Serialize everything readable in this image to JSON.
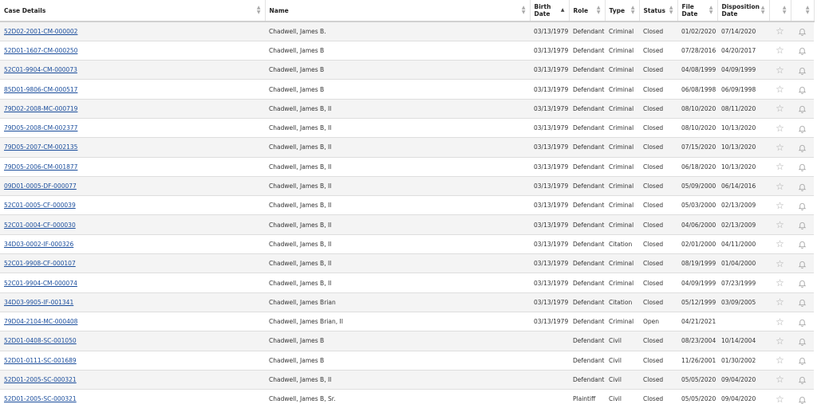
{
  "columns": {
    "case_details": "Case Details",
    "name": "Name",
    "birth_date": "Birth Date",
    "role": "Role",
    "type": "Type",
    "status": "Status",
    "file_date": "File Date",
    "disposition_date": "Disposition Date"
  },
  "icons": {
    "favorite": "star-outline-icon",
    "alert": "bell-outline-icon",
    "sort": "sort-arrows-icon"
  },
  "colors": {
    "link": "#1a4d9c",
    "row_alt": "#f4f4f4",
    "icon": "#a8a8a8"
  },
  "rows": [
    {
      "case": "52D02-2001-CM-000002",
      "name": "Chadwell, James B.",
      "birth": "03/13/1979",
      "role": "Defendant",
      "type": "Criminal",
      "status": "Closed",
      "file": "01/02/2020",
      "disp": "07/14/2020"
    },
    {
      "case": "52D01-1607-CM-000250",
      "name": "Chadwell, James B",
      "birth": "03/13/1979",
      "role": "Defendant",
      "type": "Criminal",
      "status": "Closed",
      "file": "07/28/2016",
      "disp": "04/20/2017"
    },
    {
      "case": "52C01-9904-CM-000073",
      "name": "Chadwell, James B",
      "birth": "03/13/1979",
      "role": "Defendant",
      "type": "Criminal",
      "status": "Closed",
      "file": "04/08/1999",
      "disp": "04/09/1999"
    },
    {
      "case": "85D01-9806-CM-000517",
      "name": "Chadwell, James B",
      "birth": "03/13/1979",
      "role": "Defendant",
      "type": "Criminal",
      "status": "Closed",
      "file": "06/08/1998",
      "disp": "06/09/1998"
    },
    {
      "case": "79D02-2008-MC-000719",
      "name": "Chadwell, James B, II",
      "birth": "03/13/1979",
      "role": "Defendant",
      "type": "Criminal",
      "status": "Closed",
      "file": "08/10/2020",
      "disp": "08/11/2020"
    },
    {
      "case": "79D05-2008-CM-002377",
      "name": "Chadwell, James B, II",
      "birth": "03/13/1979",
      "role": "Defendant",
      "type": "Criminal",
      "status": "Closed",
      "file": "08/10/2020",
      "disp": "10/13/2020"
    },
    {
      "case": "79D05-2007-CM-002135",
      "name": "Chadwell, James B, II",
      "birth": "03/13/1979",
      "role": "Defendant",
      "type": "Criminal",
      "status": "Closed",
      "file": "07/15/2020",
      "disp": "10/13/2020"
    },
    {
      "case": "79D05-2006-CM-001877",
      "name": "Chadwell, James B, II",
      "birth": "03/13/1979",
      "role": "Defendant",
      "type": "Criminal",
      "status": "Closed",
      "file": "06/18/2020",
      "disp": "10/13/2020"
    },
    {
      "case": "09D01-0005-DF-000077",
      "name": "Chadwell, James B, II",
      "birth": "03/13/1979",
      "role": "Defendant",
      "type": "Criminal",
      "status": "Closed",
      "file": "05/09/2000",
      "disp": "06/14/2016"
    },
    {
      "case": "52C01-0005-CF-000039",
      "name": "Chadwell, James B, II",
      "birth": "03/13/1979",
      "role": "Defendant",
      "type": "Criminal",
      "status": "Closed",
      "file": "05/03/2000",
      "disp": "02/13/2009"
    },
    {
      "case": "52C01-0004-CF-000030",
      "name": "Chadwell, James B, II",
      "birth": "03/13/1979",
      "role": "Defendant",
      "type": "Criminal",
      "status": "Closed",
      "file": "04/06/2000",
      "disp": "02/13/2009"
    },
    {
      "case": "34D03-0002-IF-000326",
      "name": "Chadwell, James B, II",
      "birth": "03/13/1979",
      "role": "Defendant",
      "type": "Citation",
      "status": "Closed",
      "file": "02/01/2000",
      "disp": "04/11/2000"
    },
    {
      "case": "52C01-9908-CF-000107",
      "name": "Chadwell, James B, II",
      "birth": "03/13/1979",
      "role": "Defendant",
      "type": "Criminal",
      "status": "Closed",
      "file": "08/19/1999",
      "disp": "01/04/2000"
    },
    {
      "case": "52C01-9904-CM-000074",
      "name": "Chadwell, James B, II",
      "birth": "03/13/1979",
      "role": "Defendant",
      "type": "Criminal",
      "status": "Closed",
      "file": "04/09/1999",
      "disp": "07/23/1999"
    },
    {
      "case": "34D03-9905-IF-001341",
      "name": "Chadwell, James Brian",
      "birth": "03/13/1979",
      "role": "Defendant",
      "type": "Citation",
      "status": "Closed",
      "file": "05/12/1999",
      "disp": "03/09/2005"
    },
    {
      "case": "79D04-2104-MC-000408",
      "name": "Chadwell, James Brian, II",
      "birth": "03/13/1979",
      "role": "Defendant",
      "type": "Criminal",
      "status": "Open",
      "file": "04/21/2021",
      "disp": ""
    },
    {
      "case": "52D01-0408-SC-001050",
      "name": "Chadwell, James B",
      "birth": "",
      "role": "Defendant",
      "type": "Civil",
      "status": "Closed",
      "file": "08/23/2004",
      "disp": "10/14/2004"
    },
    {
      "case": "52D01-0111-SC-001689",
      "name": "Chadwell, James B",
      "birth": "",
      "role": "Defendant",
      "type": "Civil",
      "status": "Closed",
      "file": "11/26/2001",
      "disp": "01/30/2002"
    },
    {
      "case": "52D01-2005-SC-000321",
      "name": "Chadwell, James B, II",
      "birth": "",
      "role": "Defendant",
      "type": "Civil",
      "status": "Closed",
      "file": "05/05/2020",
      "disp": "09/04/2020"
    },
    {
      "case": "52D01-2005-SC-000321",
      "name": "Chadwell, James B, Sr.",
      "birth": "",
      "role": "Plaintiff",
      "type": "Civil",
      "status": "Closed",
      "file": "05/05/2020",
      "disp": "09/04/2020"
    }
  ]
}
